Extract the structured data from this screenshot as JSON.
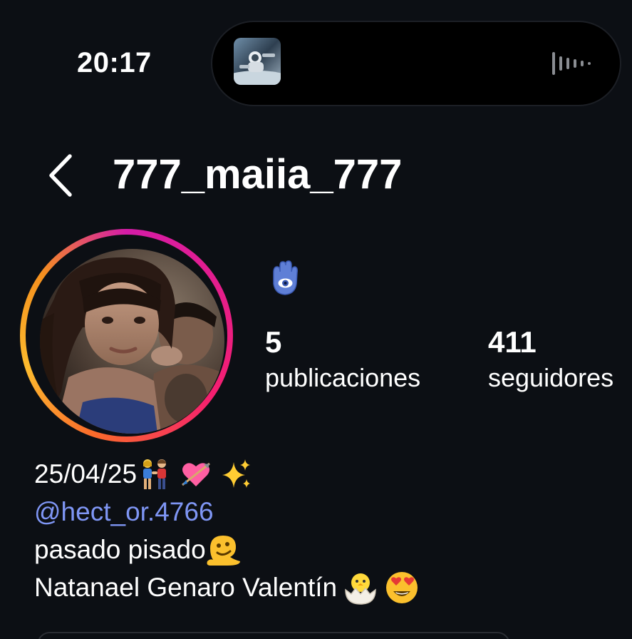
{
  "status_bar": {
    "time": "20:17"
  },
  "header": {
    "username": "777_maiia_777",
    "back_icon": "chevron-left-icon"
  },
  "profile": {
    "note_emoji_icon": "hamsa-icon",
    "stats": [
      {
        "value": "5",
        "label": "publicaciones"
      },
      {
        "value": "411",
        "label": "seguidores"
      }
    ]
  },
  "bio": {
    "line1": "25/04/25",
    "line1_emojis": [
      "couple-icon",
      "heart-arrow-icon",
      "sparkles-icon"
    ],
    "mention": "@hect_or.4766",
    "line3": "pasado pisado",
    "line3_emoji": "melting-face-icon",
    "line4": "Natanael Genaro Valentín ",
    "line4_emojis": [
      "hatching-chick-icon",
      "heart-eyes-icon"
    ]
  },
  "colors": {
    "background": "#0c0f14",
    "mention": "#7f96f5",
    "ring_start": "#d51ca8",
    "ring_end": "#fdbb2e"
  }
}
